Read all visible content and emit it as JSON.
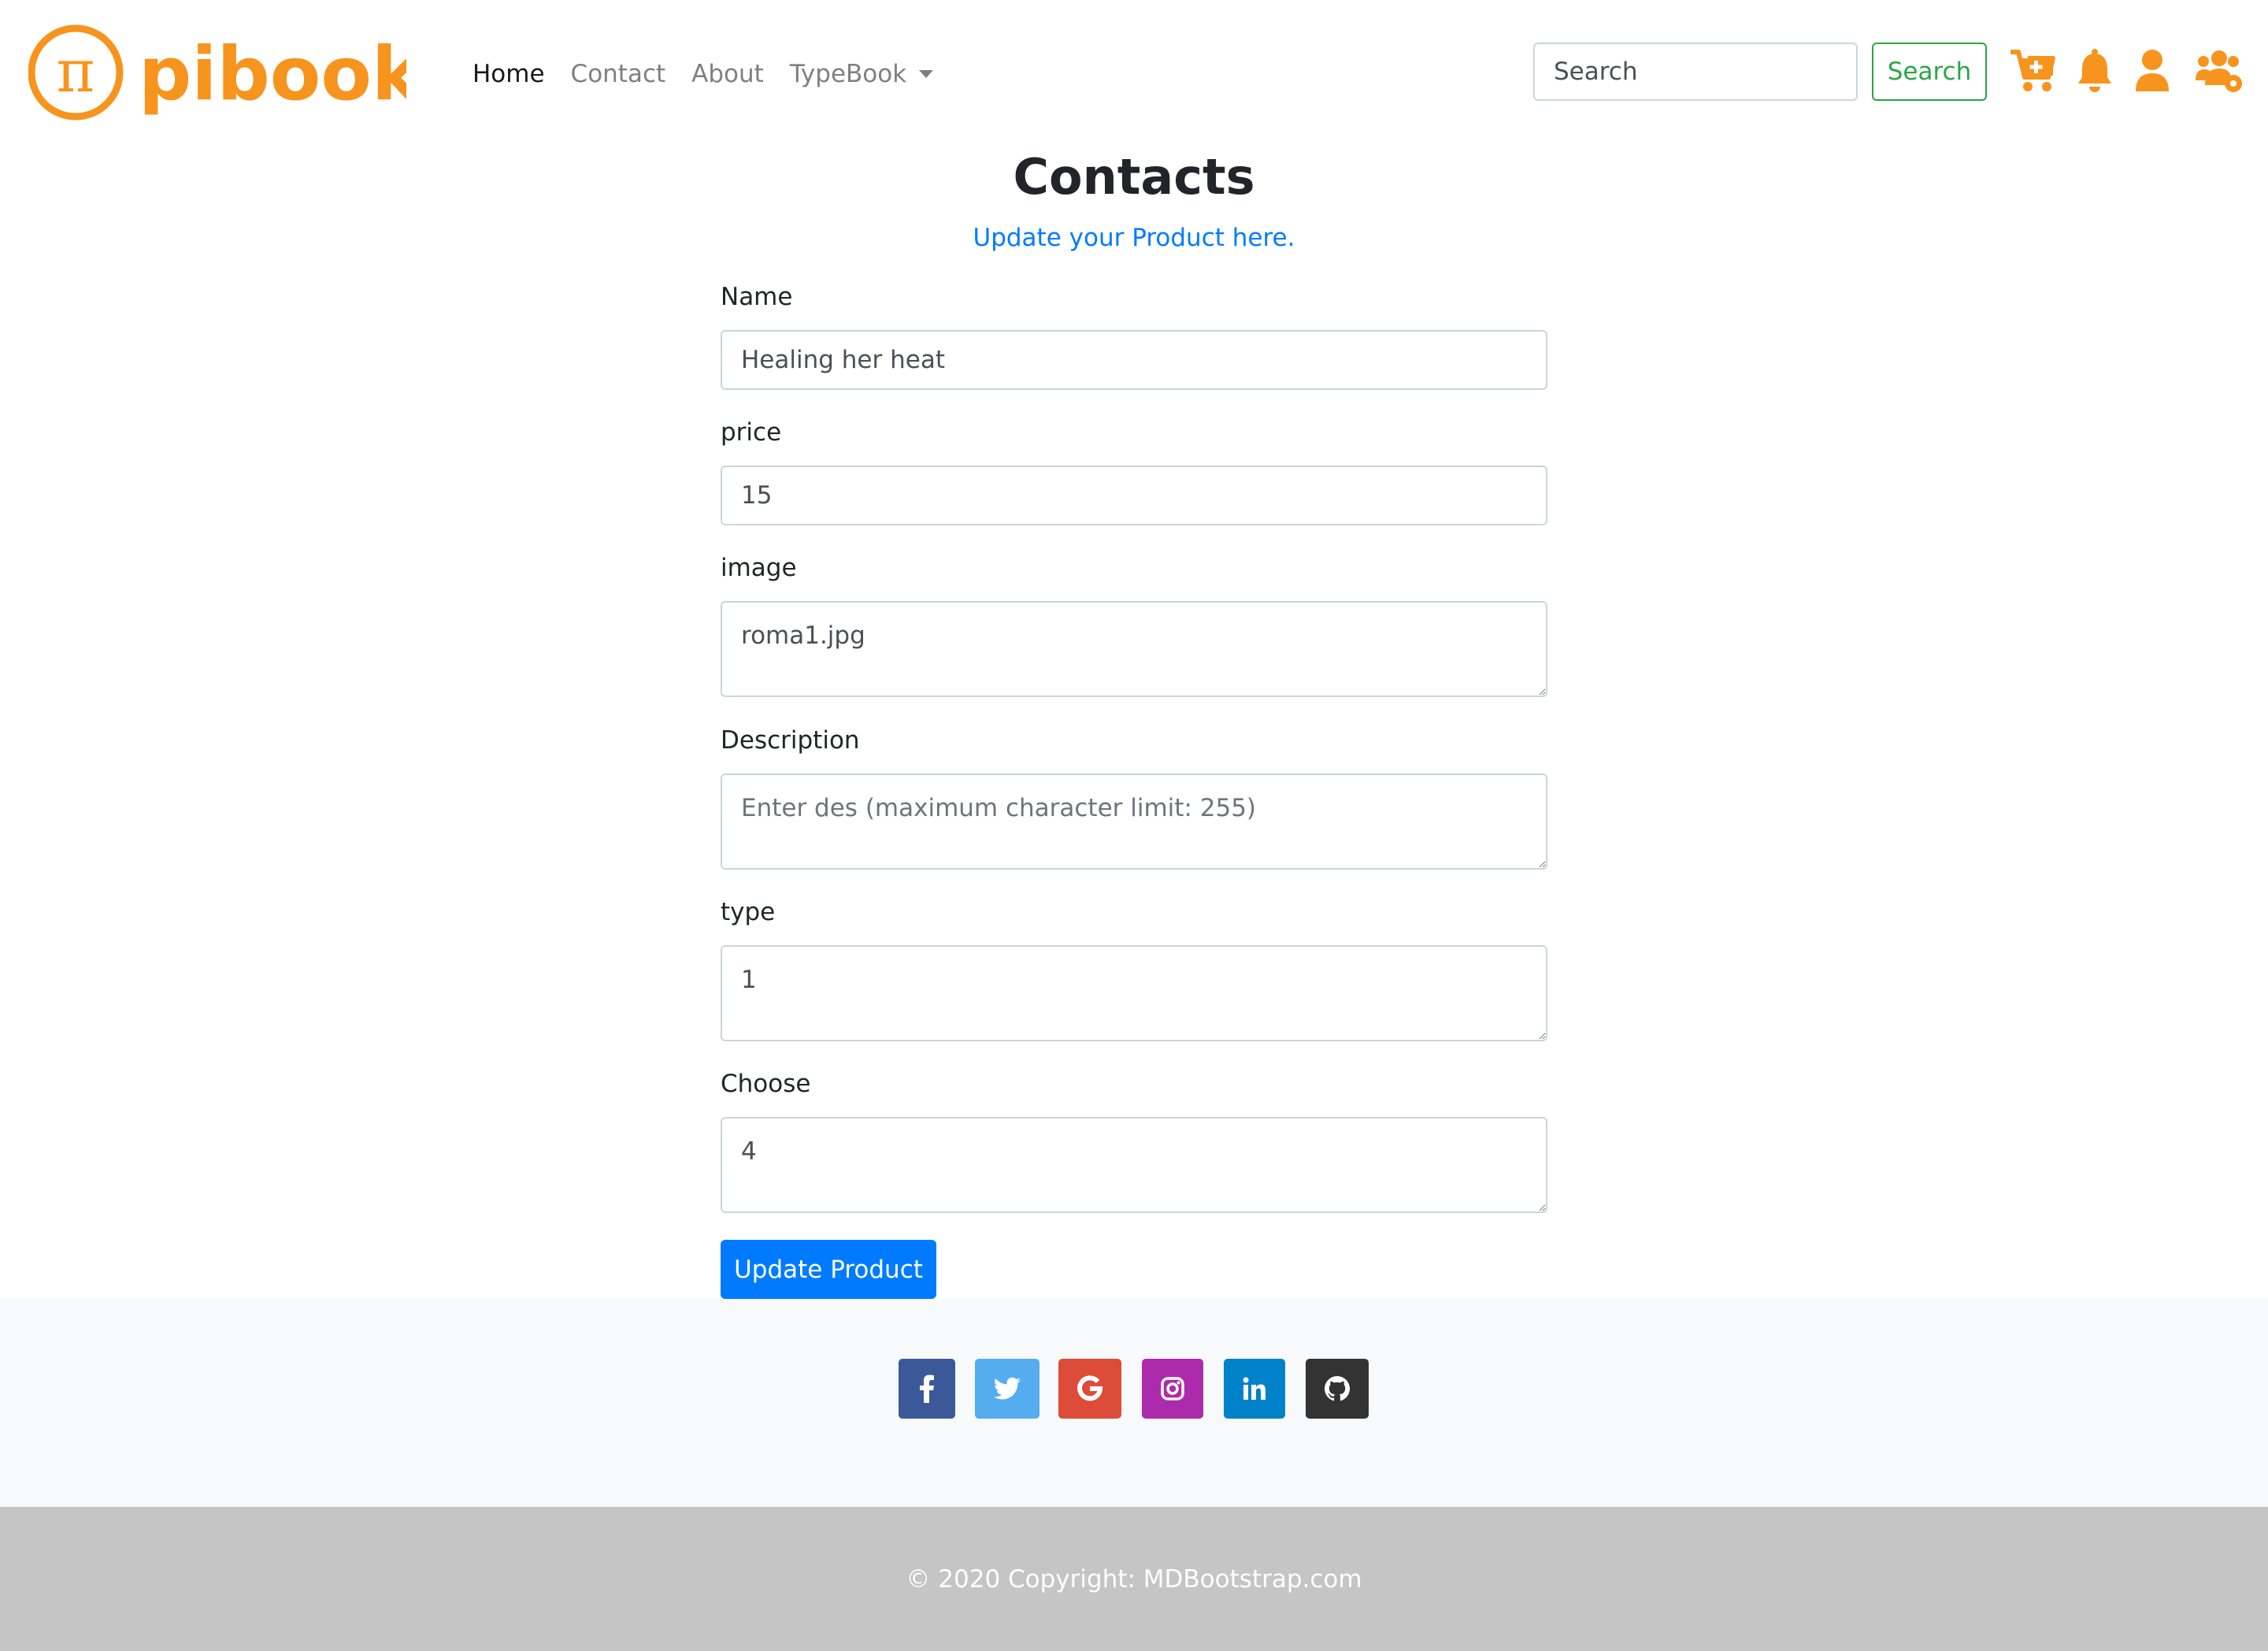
{
  "brand": {
    "name": "pibook",
    "symbol": "π",
    "color": "#f7941d"
  },
  "nav": {
    "links": [
      {
        "label": "Home",
        "active": true
      },
      {
        "label": "Contact",
        "active": false
      },
      {
        "label": "About",
        "active": false
      },
      {
        "label": "TypeBook",
        "active": false,
        "dropdown": true
      }
    ],
    "search": {
      "placeholder": "Search",
      "value": "",
      "button_label": "Search"
    },
    "icons": [
      "cart-plus-icon",
      "bell-icon",
      "user-icon",
      "users-cog-icon"
    ],
    "icon_color": "#f7941d"
  },
  "main": {
    "title": "Contacts",
    "subtitle": "Update your Product here.",
    "fields": {
      "name": {
        "label": "Name",
        "value": "Healing her heat"
      },
      "price": {
        "label": "price",
        "value": "15"
      },
      "image": {
        "label": "image",
        "value": "roma1.jpg"
      },
      "description": {
        "label": "Description",
        "value": "",
        "placeholder": "Enter des (maximum character limit: 255)"
      },
      "type": {
        "label": "type",
        "value": "1"
      },
      "choose": {
        "label": "Choose",
        "value": "4"
      }
    },
    "submit_label": "Update Product"
  },
  "footer": {
    "social": [
      {
        "name": "facebook",
        "glyph": "f",
        "color": "#3b5998"
      },
      {
        "name": "twitter",
        "glyph": "t",
        "color": "#55acee"
      },
      {
        "name": "google",
        "glyph": "G",
        "color": "#dd4b39"
      },
      {
        "name": "instagram",
        "glyph": "ig",
        "color": "#ac2bac"
      },
      {
        "name": "linkedin",
        "glyph": "in",
        "color": "#0082ca"
      },
      {
        "name": "github",
        "glyph": "gh",
        "color": "#333333"
      }
    ],
    "copyright": "© 2020 Copyright: MDBootstrap.com"
  }
}
